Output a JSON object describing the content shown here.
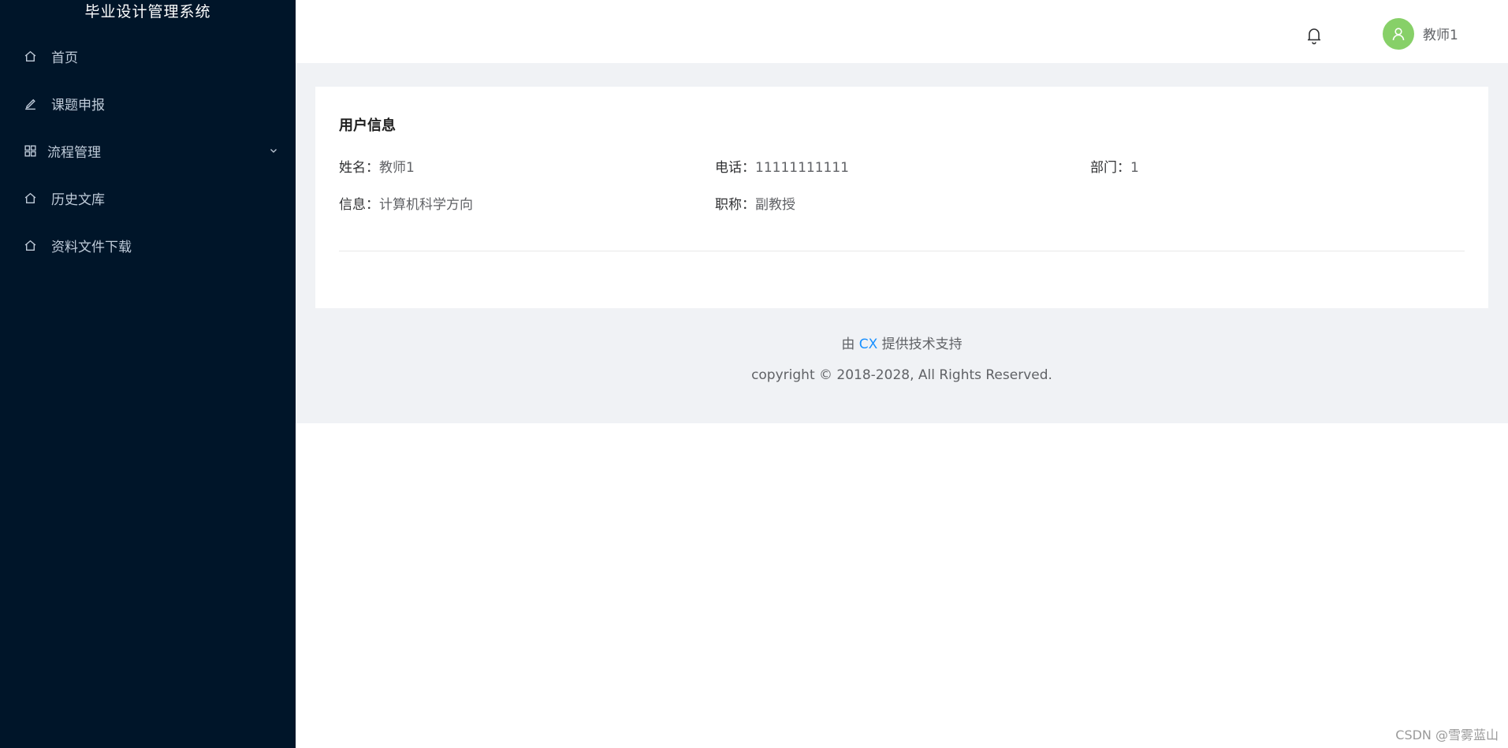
{
  "app": {
    "title": "毕业设计管理系统"
  },
  "sidebar": {
    "items": [
      {
        "label": "首页",
        "icon": "home-icon"
      },
      {
        "label": "课题申报",
        "icon": "edit-icon"
      },
      {
        "label": "流程管理",
        "icon": "grid-icon",
        "expandable": true
      },
      {
        "label": "历史文库",
        "icon": "home-icon"
      },
      {
        "label": "资料文件下载",
        "icon": "home-icon"
      }
    ]
  },
  "header": {
    "notification_icon": "bell-icon",
    "avatar_color": "#87d068",
    "username": "教师1"
  },
  "user_info": {
    "title": "用户信息",
    "fields": {
      "name": {
        "label": "姓名：",
        "value": "教师1"
      },
      "phone": {
        "label": "电话：",
        "value": "11111111111"
      },
      "department": {
        "label": "部门：",
        "value": "1"
      },
      "info": {
        "label": "信息：",
        "value": "计算机科学方向"
      },
      "job_title": {
        "label": "职称：",
        "value": "副教授"
      }
    }
  },
  "footer": {
    "support_prefix": "由 ",
    "support_link": "CX",
    "support_suffix": " 提供技术支持",
    "copyright": "copyright © 2018-2028, All Rights Reserved."
  },
  "watermark": "CSDN @雪雾蓝山",
  "colors": {
    "sidebar_bg": "#001529",
    "content_bg": "#f0f2f5",
    "link": "#1890ff"
  }
}
